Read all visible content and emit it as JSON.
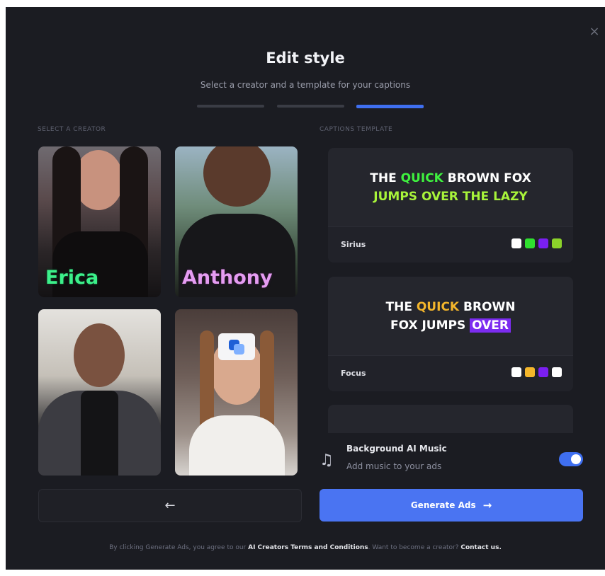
{
  "modal": {
    "title": "Edit style",
    "subtitle": "Select a creator and a template for your captions",
    "close_label": "×"
  },
  "sections": {
    "creator_label": "SELECT A CREATOR",
    "template_label": "CAPTIONS TEMPLATE"
  },
  "creators": [
    {
      "name": "Erica",
      "name_color": "#3cf08a"
    },
    {
      "name": "Anthony",
      "name_color": "#e59cf2"
    },
    {
      "name": "",
      "name_color": "#ffffff"
    },
    {
      "name": "",
      "name_color": "#ffffff"
    }
  ],
  "templates": [
    {
      "name": "Sirius",
      "line1": [
        "THE ",
        "QUICK",
        " BROWN FOX"
      ],
      "line2": "JUMPS OVER THE LAZY",
      "swatches": [
        "#ffffff",
        "#2fe02f",
        "#7a1ff0",
        "#8bd22a"
      ]
    },
    {
      "name": "Focus",
      "line1": [
        "THE ",
        "QUICK",
        " BROWN"
      ],
      "line2": [
        "FOX JUMPS ",
        "OVER"
      ],
      "swatches": [
        "#ffffff",
        "#f4b62b",
        "#7a1ff0",
        "#ffffff"
      ]
    }
  ],
  "music": {
    "title": "Background AI Music",
    "subtitle": "Add music to your ads",
    "enabled": true
  },
  "actions": {
    "back_icon": "←",
    "generate_label": "Generate Ads",
    "generate_icon": "→"
  },
  "footer": {
    "prefix": "By clicking Generate Ads, you agree to our ",
    "terms_link": "AI Creators Terms and Conditions",
    "middle": ". Want to become a creator? ",
    "contact_link": "Contact us."
  },
  "colors": {
    "accent": "#4a74f2",
    "background": "#1b1c22"
  }
}
